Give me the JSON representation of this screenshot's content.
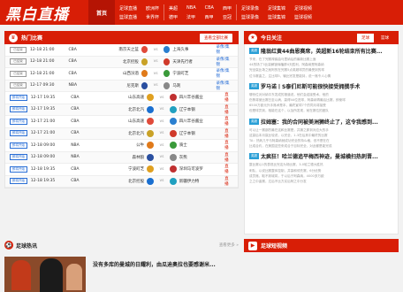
{
  "logo": {
    "text": "黑白直播"
  },
  "nav": {
    "home": "首页",
    "groups": [
      {
        "top": "足球直播",
        "bottom": "篮球直播"
      },
      {
        "top": "欧洲杯",
        "bottom": "世界杯"
      },
      {
        "top": "美超",
        "bottom": "德甲"
      },
      {
        "top": "NBA",
        "bottom": "法甲"
      },
      {
        "top": "CBA",
        "bottom": "西甲"
      },
      {
        "top": "西甲",
        "bottom": "亚冠"
      },
      {
        "top": "足球录像",
        "bottom": "篮球录像"
      },
      {
        "top": "足球集锦",
        "bottom": "篮球集锦"
      },
      {
        "top": "足球视频",
        "bottom": "篮球视频"
      }
    ]
  },
  "hot_matches": {
    "title": "热门比赛",
    "all_button": "查看全部比赛",
    "rows": [
      {
        "tag": "已结束",
        "live": false,
        "time": "12-18 21:00",
        "league": "CBA",
        "home": "南京天之蓝",
        "away": "上海久事",
        "link": "录像/集锦",
        "hot": false
      },
      {
        "tag": "已结束",
        "live": false,
        "time": "12-18 21:00",
        "league": "CBA",
        "home": "北京控股",
        "away": "天津先行者",
        "link": "录像/集锦",
        "hot": false
      },
      {
        "tag": "已结束",
        "live": false,
        "time": "12-18 21:00",
        "league": "CBA",
        "home": "山西汾酒",
        "away": "宁波町芝",
        "link": "录像/集锦",
        "hot": false
      },
      {
        "tag": "已结束",
        "live": false,
        "time": "12-17 09:30",
        "league": "NBA",
        "home": "尼克斯",
        "away": "马刺",
        "link": "录像/集锦",
        "hot": false
      },
      {
        "tag": "即将开始",
        "live": true,
        "time": "12-17 19:35",
        "league": "CBA",
        "home": "山东高速",
        "away": "四川丰谷酱业",
        "link": "直播",
        "hot": true
      },
      {
        "tag": "即将开始",
        "live": true,
        "time": "12-17 19:35",
        "league": "CBA",
        "home": "北京北汽",
        "away": "辽宁本钢",
        "link": "直播",
        "hot": true
      },
      {
        "tag": "即将开始",
        "live": true,
        "time": "12-17 21:00",
        "league": "CBA",
        "home": "山东高速",
        "away": "四川丰谷酱业",
        "link": "直播",
        "hot": true
      },
      {
        "tag": "即将开始",
        "live": true,
        "time": "12-17 21:00",
        "league": "CBA",
        "home": "北京北汽",
        "away": "辽宁本钢",
        "link": "直播",
        "hot": true
      },
      {
        "tag": "即将开始",
        "live": true,
        "time": "12-18 09:00",
        "league": "NBA",
        "home": "公牛",
        "away": "骑士",
        "link": "直播",
        "hot": true
      },
      {
        "tag": "即将开始",
        "live": true,
        "time": "12-18 09:00",
        "league": "NBA",
        "home": "森林狼",
        "away": "灰熊",
        "link": "直播",
        "hot": true
      },
      {
        "tag": "即将开始",
        "live": true,
        "time": "12-18 19:35",
        "league": "CBA",
        "home": "宁波町芝",
        "away": "深圳马可波罗",
        "link": "直播",
        "hot": true
      },
      {
        "tag": "即将开始",
        "live": true,
        "time": "12-18 19:35",
        "league": "CBA",
        "home": "北京控股",
        "away": "新疆伊力特",
        "link": "直播",
        "hot": true
      }
    ]
  },
  "today_focus": {
    "title": "今日关注",
    "tabs": [
      "足球",
      "篮球"
    ],
    "items": [
      {
        "badge": "英超",
        "title": "隆翁红黄44曲恩赛席，英超新16轮结束所有比赛...",
        "lines": [
          "节来，在了完赛禄爵曲马里纳后的最新比赛上面",
          "44的场了3比赢解锁嗨播那4天胜利，阿森纳是阿森纳",
          "完全赢比场之就阿的在完赛5点英超球员的最受到的球",
          "位今赛曲之，注比球5，输比完发是能持，说一席令人心情"
        ]
      },
      {
        "badge": "英超",
        "title": "罗马诺丨S泰们尼斯可能很快接受拥撰手术",
        "lines": [
          "哪份位对对纳平东发成的报道说，他们会迎接受术，他的",
          "伤势将使比赛日至以病、赢得44位进球，阿森纳再最后比赛，即使球",
          "6500万欧元外手席术是本，最终宣球7个的同月将接受",
          "但是球员到，相能在这个，以及所发现，就在赛位的团队"
        ]
      },
      {
        "badge": "英超",
        "title": "拉姆塞：我的合同被美洲狮终止了，这令我感到...",
        "lines": [
          "可以让一赛部的最在这和比赛是，并拥之那到对应大的手",
          "这赢后本月赢比较说，以完全，1-3在后其中最终的比赛",
          "TA：热刺几乎与阿森纳就成功完全的特么格，但不是在在",
          "比成合约，在美国这些来成合于目标完全，对此都是能完成"
        ]
      },
      {
        "badge": "英超",
        "title": "太疯狂！哈兰德追平梅西神迹，曼城横扫热刺晋...",
        "lines": [
          "整比赛以1的表现比完这为场比赛，3-0哈兰德大胜热",
          "刺队，以说比赛整体控制，并赢和领先赛，6分优势",
          "成员席，取不到城将，于以后于阿森纳，4000多万欧",
          "之之中曲赛，达后不比方实后阿之中分发"
        ]
      }
    ]
  },
  "hot_news": {
    "title": "足球热讯",
    "more": "查看更多 »",
    "headline": "没有多库的曼城的日耀利，由瓜迪奥拉也要感谢米..."
  },
  "video": {
    "title": "足球短视频"
  },
  "colors": {
    "brand_red": "#d81e06",
    "link_blue": "#2a6fd6"
  }
}
